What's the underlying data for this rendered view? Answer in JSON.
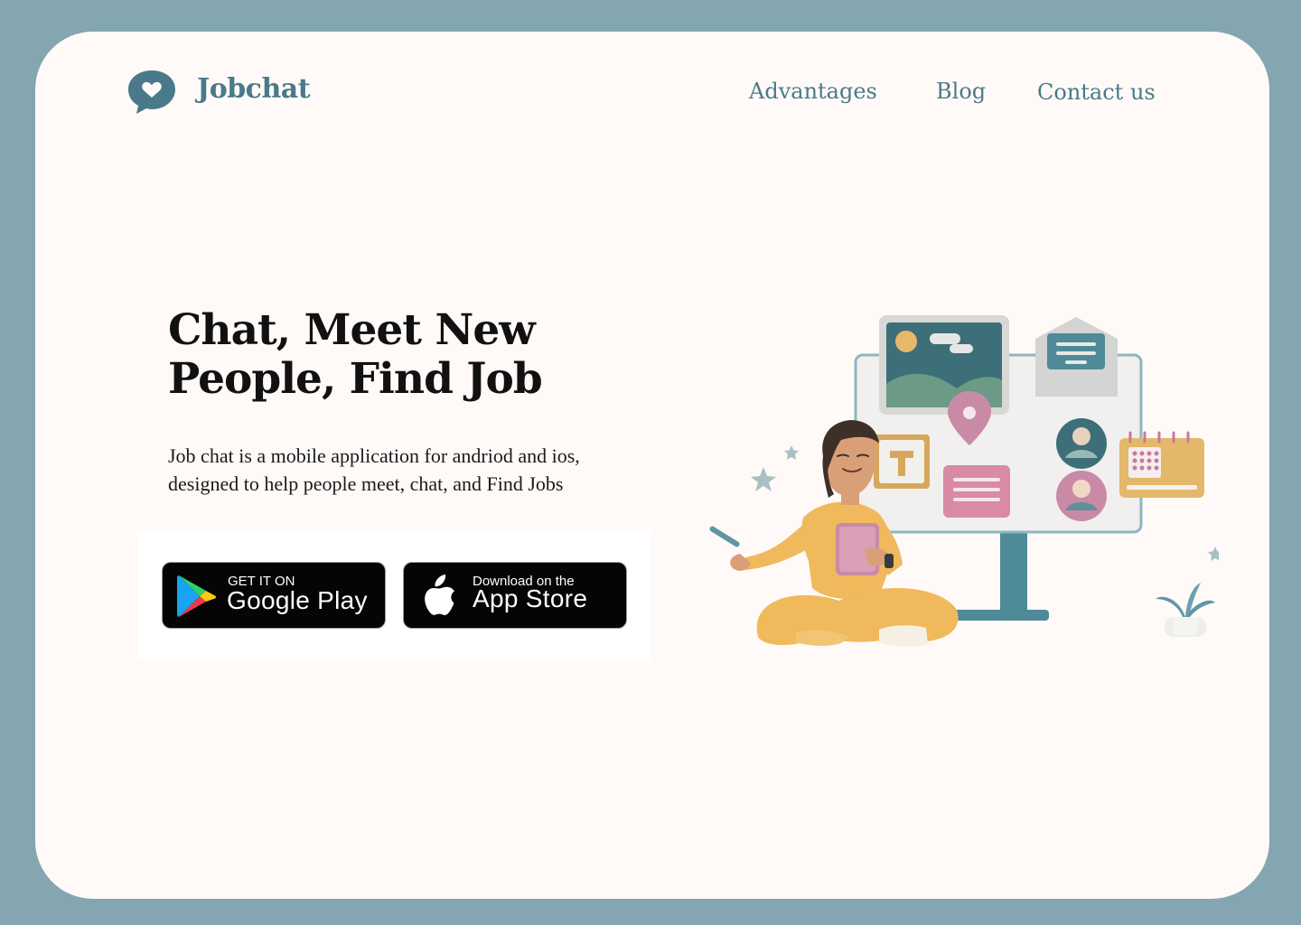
{
  "brand": {
    "name": "Jobchat",
    "logo_icon": "chat-bubble-heart-icon"
  },
  "nav": {
    "items": [
      "Advantages",
      "Blog",
      "Contact us"
    ]
  },
  "hero": {
    "title": "Chat, Meet New People, Find Job",
    "description": "Job chat is a mobile application for andriod and ios, designed to help people meet, chat, and Find Jobs"
  },
  "stores": {
    "google": {
      "small": "GET IT ON",
      "big": "Google Play",
      "icon": "google-play-icon"
    },
    "apple": {
      "small": "Download on the",
      "big": "App Store",
      "icon": "apple-icon"
    }
  },
  "colors": {
    "frame": "#84a6b0",
    "card": "#fffaf8",
    "accent": "#4a7a8a",
    "heading": "#111111",
    "badge": "#050505"
  }
}
